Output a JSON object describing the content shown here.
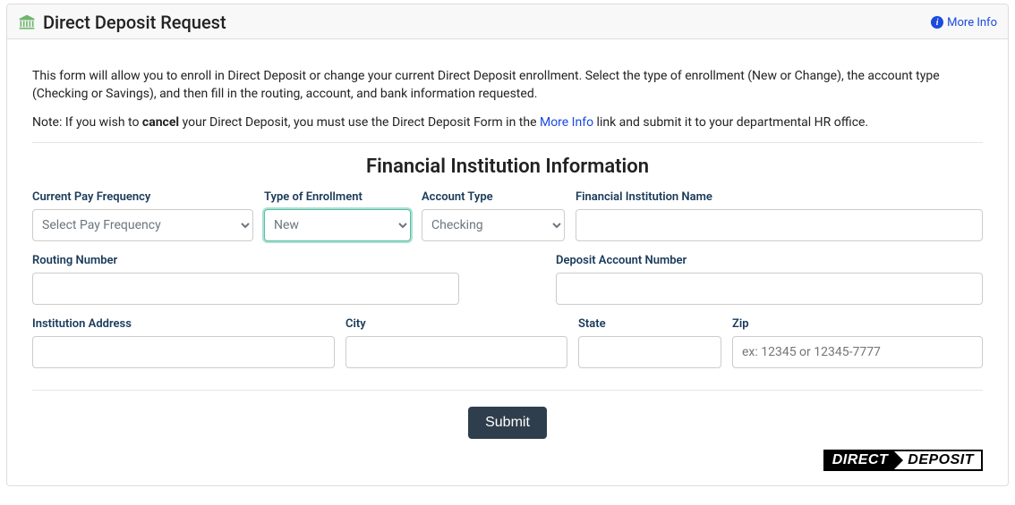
{
  "header": {
    "title": "Direct Deposit Request",
    "more_info": "More Info"
  },
  "intro": "This form will allow you to enroll in Direct Deposit or change your current Direct Deposit enrollment. Select the type of enrollment (New or Change), the account type (Checking or Savings), and then fill in the routing, account, and bank information requested.",
  "note": {
    "prefix": "Note: If you wish to ",
    "cancel": "cancel",
    "middle": " your Direct Deposit, you must use the Direct Deposit Form in the ",
    "link": "More Info",
    "suffix": " link and submit it to your departmental HR office."
  },
  "section_title": "Financial Institution Information",
  "labels": {
    "pay_frequency": "Current Pay Frequency",
    "enrollment": "Type of Enrollment",
    "account_type": "Account Type",
    "fin_name": "Financial Institution Name",
    "routing": "Routing Number",
    "deposit_acct": "Deposit Account Number",
    "address": "Institution Address",
    "city": "City",
    "state": "State",
    "zip": "Zip"
  },
  "values": {
    "pay_frequency_selected": "Select Pay Frequency",
    "enrollment_selected": "New",
    "account_type_selected": "Checking",
    "fin_name": "",
    "routing": "",
    "deposit_acct": "",
    "address": "",
    "city": "",
    "state": "",
    "zip": ""
  },
  "placeholders": {
    "zip": "ex: 12345 or 12345-7777"
  },
  "submit_label": "Submit",
  "logo": {
    "left": "DIRECT",
    "right": "DEPOSIT"
  }
}
